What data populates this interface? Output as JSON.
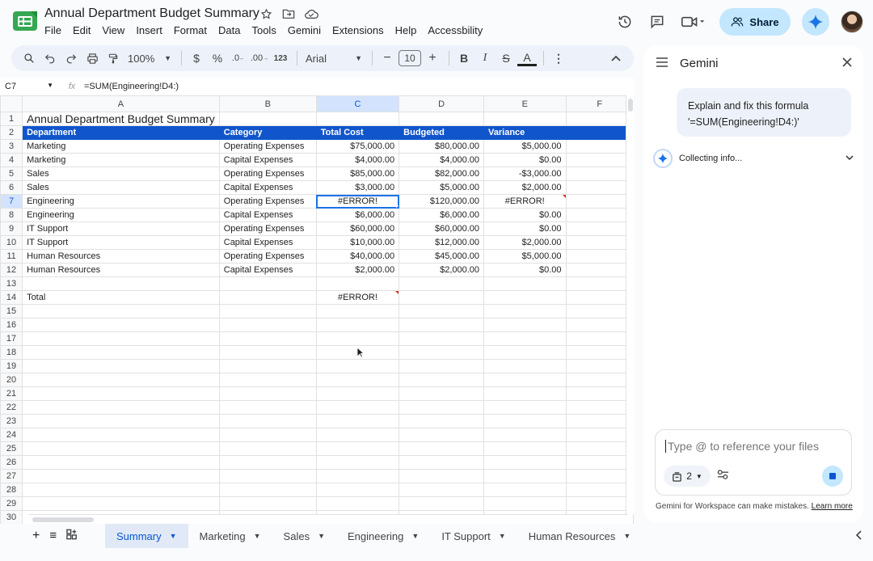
{
  "app": {
    "doc_title": "Annual Department Budget Summary",
    "menu": [
      "File",
      "Edit",
      "View",
      "Insert",
      "Format",
      "Data",
      "Tools",
      "Gemini",
      "Extensions",
      "Help",
      "Accessbility"
    ],
    "share_label": "Share"
  },
  "toolbar": {
    "zoom": "100%",
    "font": "Arial",
    "font_size": "10",
    "number_format_label": "123"
  },
  "formula_bar": {
    "cell_ref": "C7",
    "formula": "=SUM(Engineering!D4:)"
  },
  "grid": {
    "columns": [
      "A",
      "B",
      "C",
      "D",
      "E",
      "F"
    ],
    "row_numbers": [
      "1",
      "2",
      "3",
      "4",
      "5",
      "6",
      "7",
      "8",
      "9",
      "10",
      "11",
      "12",
      "13",
      "14",
      "15",
      "16",
      "17",
      "18",
      "19",
      "20",
      "21",
      "22",
      "23",
      "24",
      "25",
      "26",
      "27",
      "28",
      "29",
      "30"
    ],
    "title": "Annual Department Budget Summary",
    "headers": [
      "Department",
      "Category",
      "Total Cost",
      "Budgeted",
      "Variance"
    ],
    "rows": [
      [
        "Marketing",
        "Operating Expenses",
        "$75,000.00",
        "$80,000.00",
        "$5,000.00"
      ],
      [
        "Marketing",
        "Capital Expenses",
        "$4,000.00",
        "$4,000.00",
        "$0.00"
      ],
      [
        "Sales",
        "Operating Expenses",
        "$85,000.00",
        "$82,000.00",
        "-$3,000.00"
      ],
      [
        "Sales",
        "Capital Expenses",
        "$3,000.00",
        "$5,000.00",
        "$2,000.00"
      ],
      [
        "Engineering",
        "Operating Expenses",
        "#ERROR!",
        "$120,000.00",
        "#ERROR!"
      ],
      [
        "Engineering",
        "Capital Expenses",
        "$6,000.00",
        "$6,000.00",
        "$0.00"
      ],
      [
        "IT Support",
        "Operating Expenses",
        "$60,000.00",
        "$60,000.00",
        "$0.00"
      ],
      [
        "IT Support",
        "Capital Expenses",
        "$10,000.00",
        "$12,000.00",
        "$2,000.00"
      ],
      [
        "Human Resources",
        "Operating Expenses",
        "$40,000.00",
        "$45,000.00",
        "$5,000.00"
      ],
      [
        "Human Resources",
        "Capital Expenses",
        "$2,000.00",
        "$2,000.00",
        "$0.00"
      ]
    ],
    "total_label": "Total",
    "total_value": "#ERROR!"
  },
  "sheet_tabs": [
    "Summary",
    "Marketing",
    "Sales",
    "Engineering",
    "IT Support",
    "Human Resources"
  ],
  "gemini": {
    "title": "Gemini",
    "user_prompt_line1": "Explain and fix this formula",
    "user_prompt_line2": "'=SUM(Engineering!D4:)'",
    "status": "Collecting info...",
    "input_placeholder": "Type @ to reference your files",
    "sources_count": "2",
    "disclaimer": "Gemini for Workspace can make mistakes.",
    "learn_more": "Learn more"
  },
  "colors": {
    "header_fill": "#1155cc",
    "selection": "#1a73e8",
    "chip_blue": "#c2e7ff",
    "error_mark": "#d93025"
  }
}
